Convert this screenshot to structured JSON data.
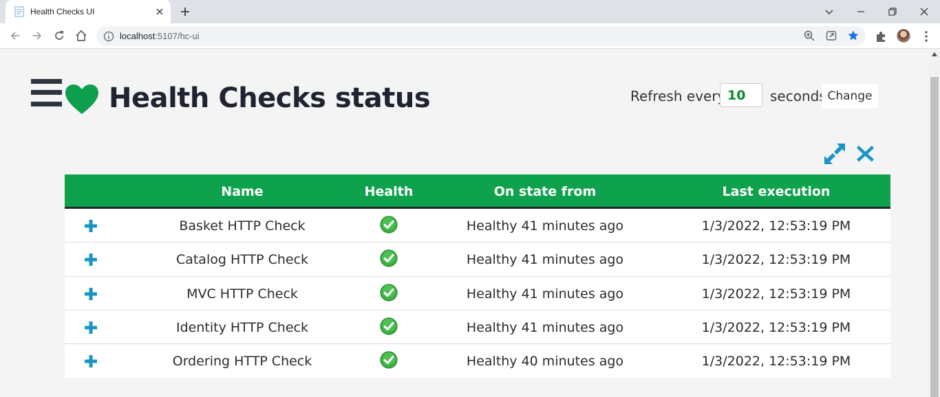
{
  "browser": {
    "tab_title": "Health Checks UI",
    "url_host": "localhost",
    "url_rest": ":5107/hc-ui"
  },
  "header": {
    "title": "Health Checks status",
    "refresh_label": "Refresh every",
    "refresh_value": "10",
    "seconds_label": "seconds",
    "change_label": "Change"
  },
  "table": {
    "columns": [
      "Name",
      "Health",
      "On state from",
      "Last execution"
    ],
    "rows": [
      {
        "name": "Basket HTTP Check",
        "health": "healthy",
        "on_state_from": "Healthy 41 minutes ago",
        "last_execution": "1/3/2022, 12:53:19 PM"
      },
      {
        "name": "Catalog HTTP Check",
        "health": "healthy",
        "on_state_from": "Healthy 41 minutes ago",
        "last_execution": "1/3/2022, 12:53:19 PM"
      },
      {
        "name": "MVC HTTP Check",
        "health": "healthy",
        "on_state_from": "Healthy 41 minutes ago",
        "last_execution": "1/3/2022, 12:53:19 PM"
      },
      {
        "name": "Identity HTTP Check",
        "health": "healthy",
        "on_state_from": "Healthy 41 minutes ago",
        "last_execution": "1/3/2022, 12:53:19 PM"
      },
      {
        "name": "Ordering HTTP Check",
        "health": "healthy",
        "on_state_from": "Healthy 40 minutes ago",
        "last_execution": "1/3/2022, 12:53:19 PM"
      }
    ]
  },
  "colors": {
    "brand_green": "#0ea24d",
    "heart_green": "#0e9f4e",
    "accent_blue": "#1b94c3",
    "refresh_value": "#0a8a2a"
  },
  "icons": {
    "menu": "hamburger-icon",
    "brand": "heart-icon",
    "expand": "expand-icon",
    "close": "close-x-icon",
    "row_expand": "plus-icon",
    "status": "check-circle-icon"
  }
}
